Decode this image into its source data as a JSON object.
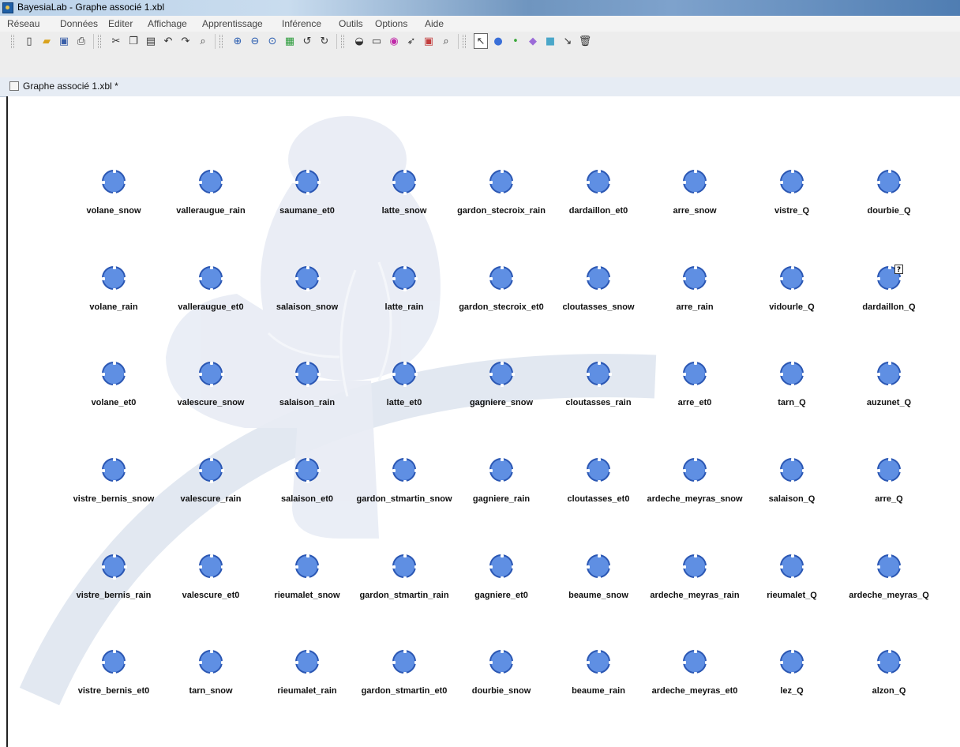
{
  "window": {
    "title": "BayesiaLab - Graphe associé 1.xbl"
  },
  "menu": [
    "Réseau",
    "Données",
    "Editer",
    "Affichage",
    "Apprentissage",
    "Inférence",
    "Outils",
    "Options",
    "Aide"
  ],
  "toolbar": {
    "groups": [
      [
        "new-file-icon",
        "open-folder-icon",
        "save-icon",
        "print-icon"
      ],
      [
        "cut-icon",
        "copy-icon",
        "paste-icon",
        "undo-icon",
        "redo-icon",
        "find-icon"
      ],
      [
        "zoom-in-icon",
        "zoom-out-icon",
        "zoom-reset-icon",
        "fit-window-icon",
        "rotate-left-icon",
        "rotate-right-icon"
      ],
      [
        "arc-type-icon",
        "decision-node-icon",
        "utility-node-icon",
        "add-arc-icon",
        "monitor-icon",
        "inspect-icon"
      ],
      [
        "select-tool-icon",
        "node-tool-icon",
        "small-node-tool-icon",
        "diamond-node-tool-icon",
        "square-node-tool-icon",
        "arc-tool-icon",
        "delete-tool-icon"
      ]
    ]
  },
  "tab": {
    "title": "Graphe associé 1.xbl *"
  },
  "graph": {
    "rows": [
      [
        "volane_snow",
        "valleraugue_rain",
        "saumane_et0",
        "latte_snow",
        "gardon_stecroix_rain",
        "dardaillon_et0",
        "arre_snow",
        "vistre_Q",
        "dourbie_Q"
      ],
      [
        "volane_rain",
        "valleraugue_et0",
        "salaison_snow",
        "latte_rain",
        "gardon_stecroix_et0",
        "cloutasses_snow",
        "arre_rain",
        "vidourle_Q",
        "dardaillon_Q"
      ],
      [
        "volane_et0",
        "valescure_snow",
        "salaison_rain",
        "latte_et0",
        "gagniere_snow",
        "cloutasses_rain",
        "arre_et0",
        "tarn_Q",
        "auzunet_Q"
      ],
      [
        "vistre_bernis_snow",
        "valescure_rain",
        "salaison_et0",
        "gardon_stmartin_snow",
        "gagniere_rain",
        "cloutasses_et0",
        "ardeche_meyras_snow",
        "salaison_Q",
        "arre_Q"
      ],
      [
        "vistre_bernis_rain",
        "valescure_et0",
        "rieumalet_snow",
        "gardon_stmartin_rain",
        "gagniere_et0",
        "beaume_snow",
        "ardeche_meyras_rain",
        "rieumalet_Q",
        "ardeche_meyras_Q"
      ],
      [
        "vistre_bernis_et0",
        "tarn_snow",
        "rieumalet_rain",
        "gardon_stmartin_et0",
        "dourbie_snow",
        "beaume_rain",
        "ardeche_meyras_et0",
        "lez_Q",
        "alzon_Q"
      ]
    ],
    "badge": {
      "node": "dardaillon_Q",
      "text": "?"
    }
  }
}
